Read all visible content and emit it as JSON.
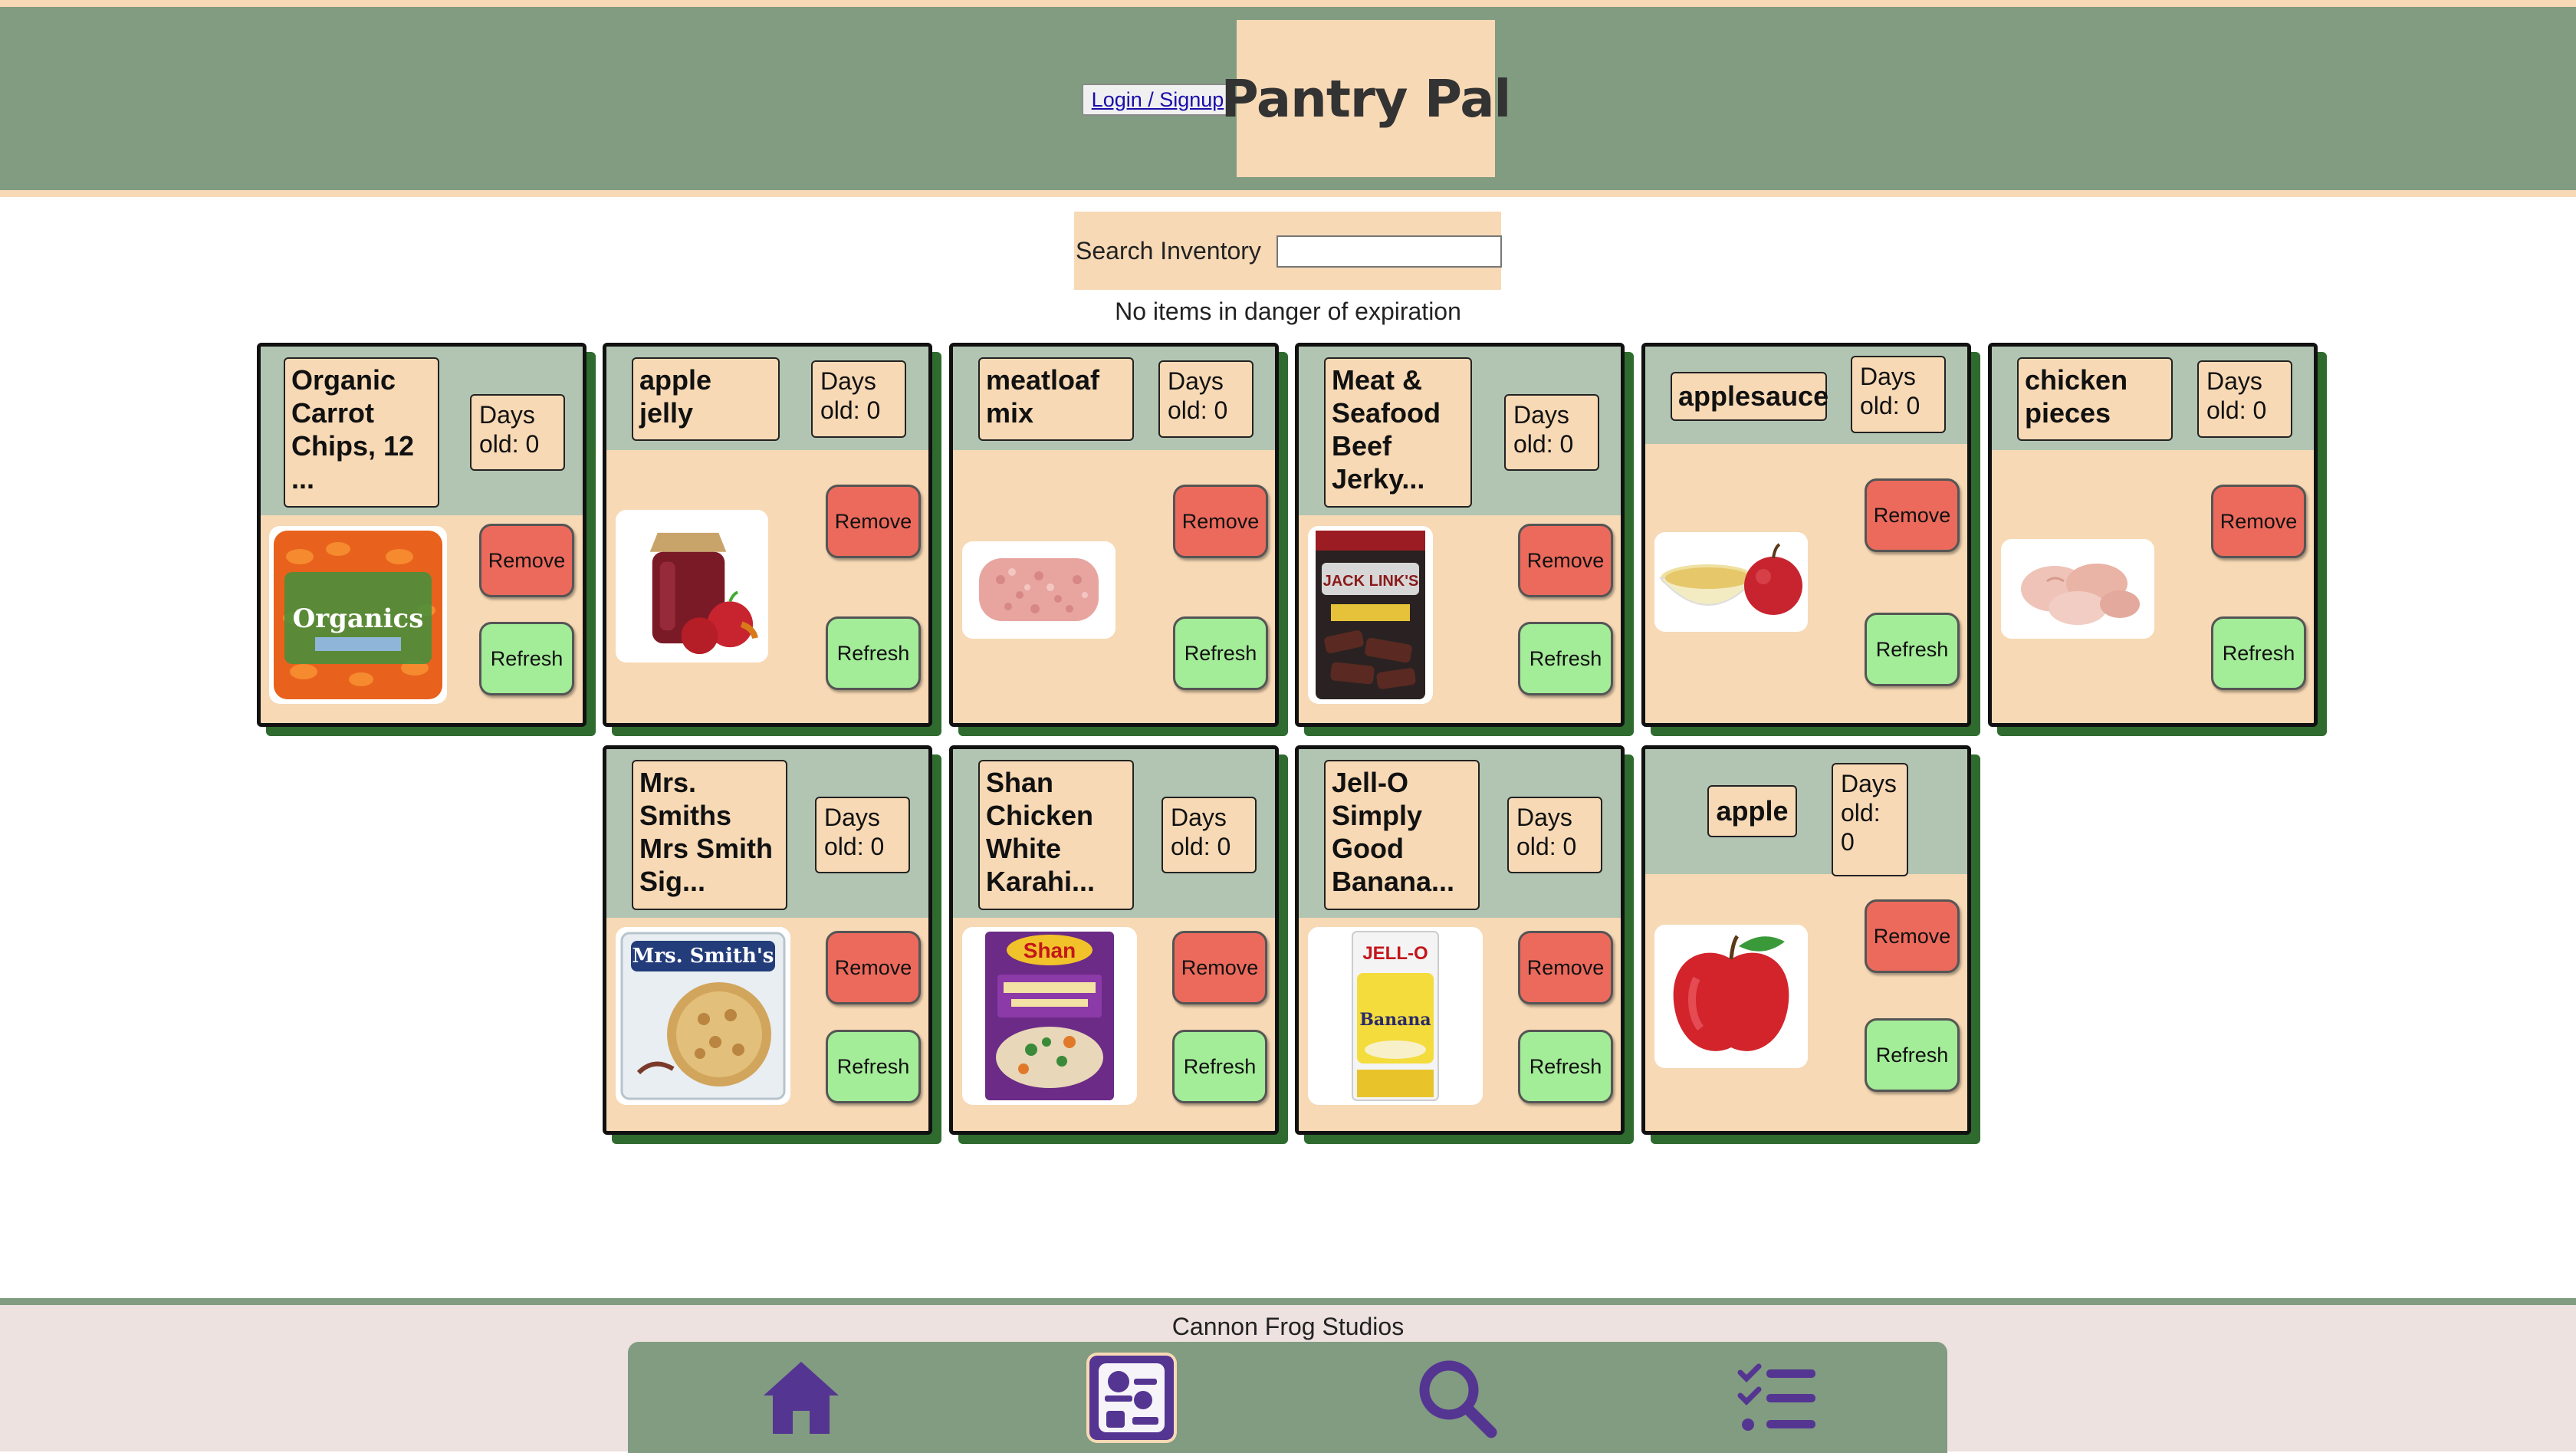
{
  "header": {
    "login_label": "Login / Signup",
    "title": "Pantry Pal"
  },
  "search": {
    "label": "Search Inventory",
    "placeholder": "",
    "value": ""
  },
  "warning_text": "No items in danger of expiration",
  "items": [
    {
      "name": "Organic Carrot Chips, 12 ...",
      "days": "Days old: 0",
      "remove_label": "Remove",
      "refresh_label": "Refresh",
      "image": "carrots-image"
    },
    {
      "name": "apple jelly",
      "days": "Days old: 0",
      "remove_label": "Remove",
      "refresh_label": "Refresh",
      "image": "jelly-jar-image"
    },
    {
      "name": "meatloaf mix",
      "days": "Days old: 0",
      "remove_label": "Remove",
      "refresh_label": "Refresh",
      "image": "ground-meat-image"
    },
    {
      "name": "Meat & Seafood Beef Jerky...",
      "days": "Days old: 0",
      "remove_label": "Remove",
      "refresh_label": "Refresh",
      "image": "jerky-bag-image"
    },
    {
      "name": "applesauce",
      "days": "Days old: 0",
      "remove_label": "Remove",
      "refresh_label": "Refresh",
      "image": "applesauce-image"
    },
    {
      "name": "chicken pieces",
      "days": "Days old: 0",
      "remove_label": "Remove",
      "refresh_label": "Refresh",
      "image": "chicken-image"
    },
    {
      "name": "Mrs. Smiths Mrs Smith Sig...",
      "days": "Days old: 0",
      "remove_label": "Remove",
      "refresh_label": "Refresh",
      "image": "pie-box-image"
    },
    {
      "name": "Shan Chicken White Karahi...",
      "days": "Days old: 0",
      "remove_label": "Remove",
      "refresh_label": "Refresh",
      "image": "spice-box-image"
    },
    {
      "name": "Jell-O Simply Good Banana...",
      "days": "Days old: 0",
      "remove_label": "Remove",
      "refresh_label": "Refresh",
      "image": "pudding-box-image"
    },
    {
      "name": "apple",
      "days": "Days old: 0",
      "remove_label": "Remove",
      "refresh_label": "Refresh",
      "image": "apple-image"
    }
  ],
  "image_text": {
    "carrots": "Organics",
    "jerky": "JACK LINK'S",
    "pie": "Mrs. Smith's",
    "spice": "Shan",
    "pudding": "JELL-O",
    "pudding_flavor": "Banana"
  },
  "footer": {
    "credit": "Cannon Frog Studios"
  },
  "nav": {
    "items": [
      {
        "icon": "home-icon",
        "active": false
      },
      {
        "icon": "pantry-icon",
        "active": true
      },
      {
        "icon": "search-icon",
        "active": false
      },
      {
        "icon": "list-icon",
        "active": false
      }
    ]
  },
  "colors": {
    "header_band": "#819c81",
    "beige": "#f7d9b5",
    "card_head": "#b2c5b2",
    "remove": "#ec6a5c",
    "refresh": "#a3ec98",
    "card_shadow": "#2f6b2f",
    "nav_icon": "#553592"
  }
}
